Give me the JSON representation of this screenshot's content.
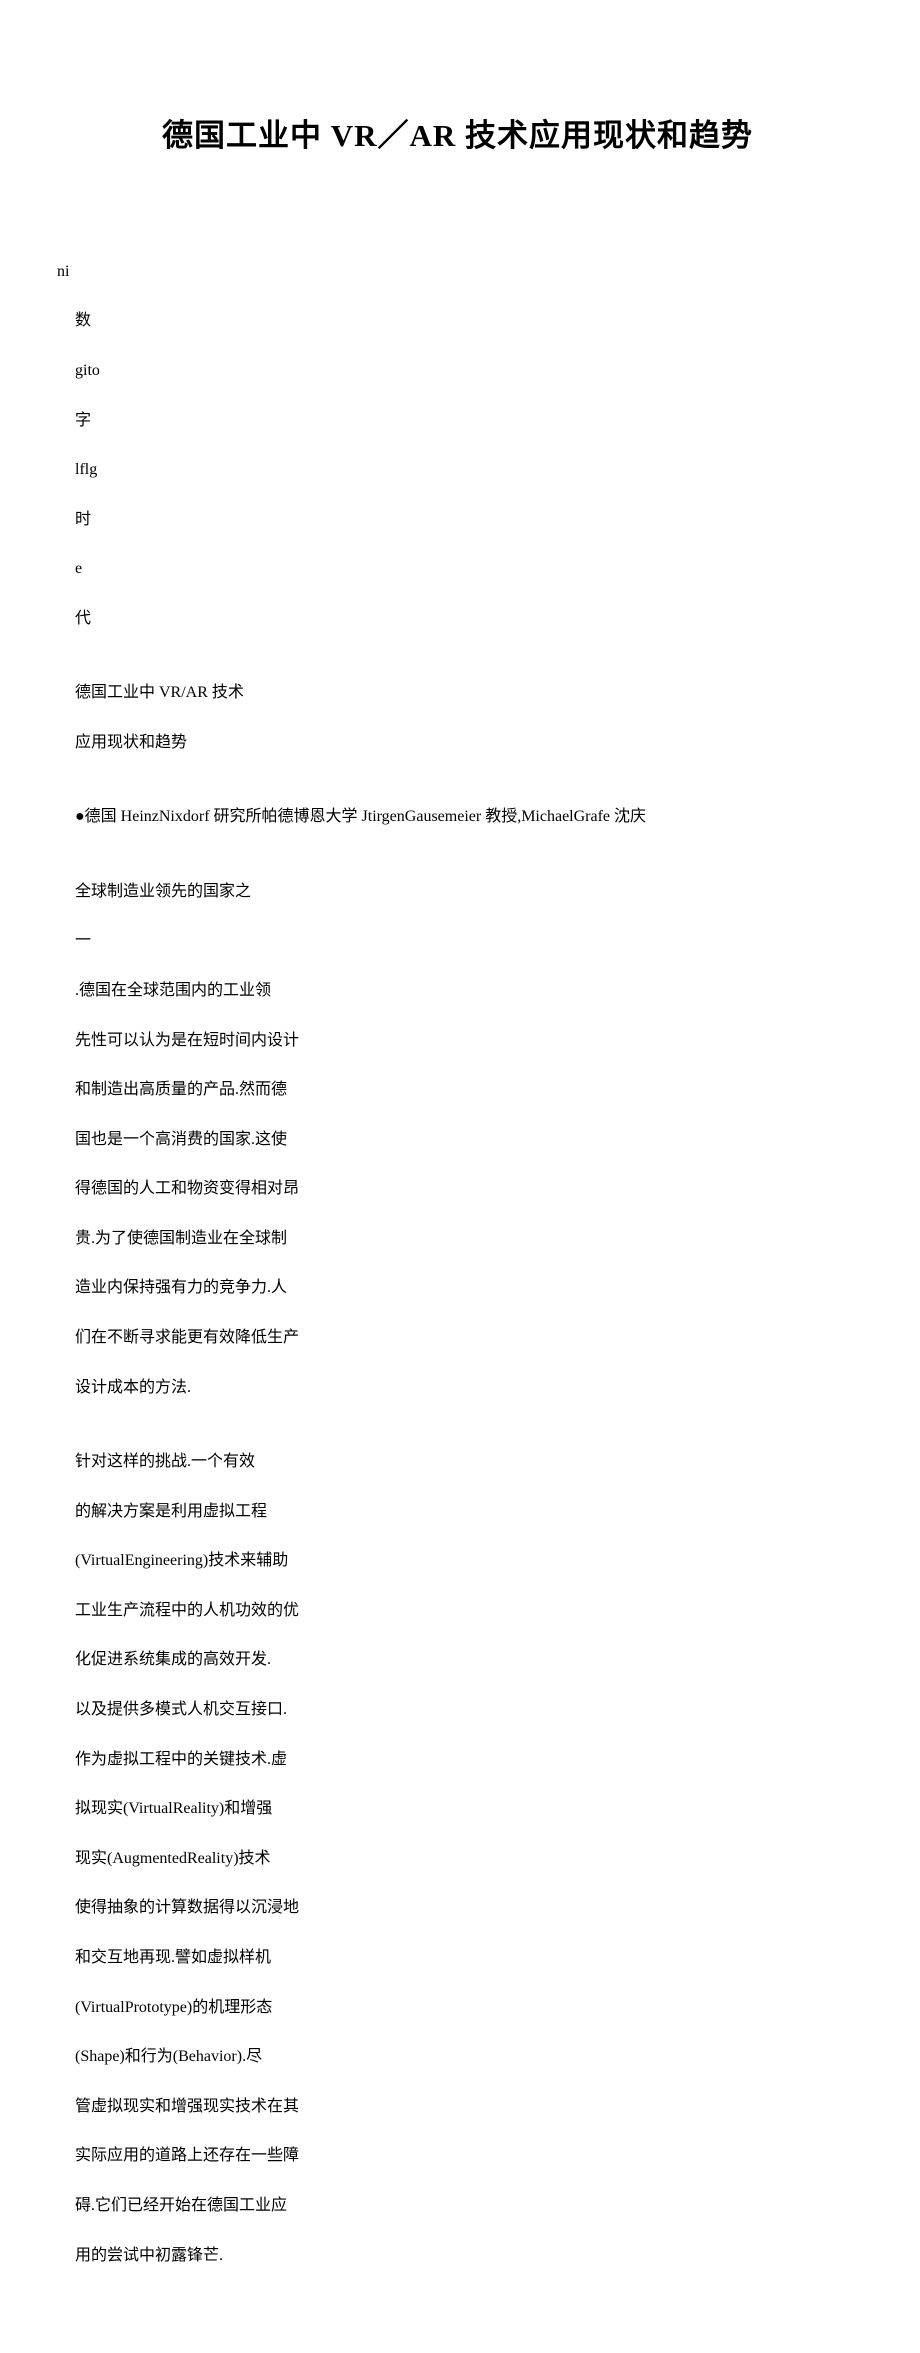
{
  "title": "德国工业中 VR／AR 技术应用现状和趋势",
  "pre_lines": [
    "ni",
    "数",
    "gito",
    "字",
    "lflg",
    "时",
    "e",
    "代"
  ],
  "meta_lines": [
    "德国工业中 VR/AR 技术",
    "应用现状和趋势"
  ],
  "byline": "●德国 HeinzNixdorf 研究所帕德博恩大学 JtirgenGausemeier 教授,MichaelGrafe 沈庆",
  "para1": [
    "全球制造业领先的国家之",
    "一",
    ".德国在全球范围内的工业领",
    "先性可以认为是在短时间内设计",
    "和制造出高质量的产品.然而德",
    "国也是一个高消费的国家.这使",
    "得德国的人工和物资变得相对昂",
    "贵.为了使德国制造业在全球制",
    "造业内保持强有力的竞争力.人",
    "们在不断寻求能更有效降低生产",
    "设计成本的方法."
  ],
  "para2": [
    "针对这样的挑战.一个有效",
    "的解决方案是利用虚拟工程",
    "(VirtualEngineering)技术来辅助",
    "工业生产流程中的人机功效的优",
    "化促进系统集成的高效开发.",
    "以及提供多模式人机交互接口.",
    "作为虚拟工程中的关键技术.虚",
    "拟现实(VirtualReality)和增强",
    "现实(AugmentedReality)技术",
    "使得抽象的计算数据得以沉浸地",
    "和交互地再现.譬如虚拟样机",
    "(VirtualPrototype)的机理形态",
    "(Shape)和行为(Behavior).尽",
    "管虚拟现实和增强现实技术在其",
    "实际应用的道路上还存在一些障",
    "碍.它们已经开始在德国工业应",
    "用的尝试中初露锋芒."
  ]
}
